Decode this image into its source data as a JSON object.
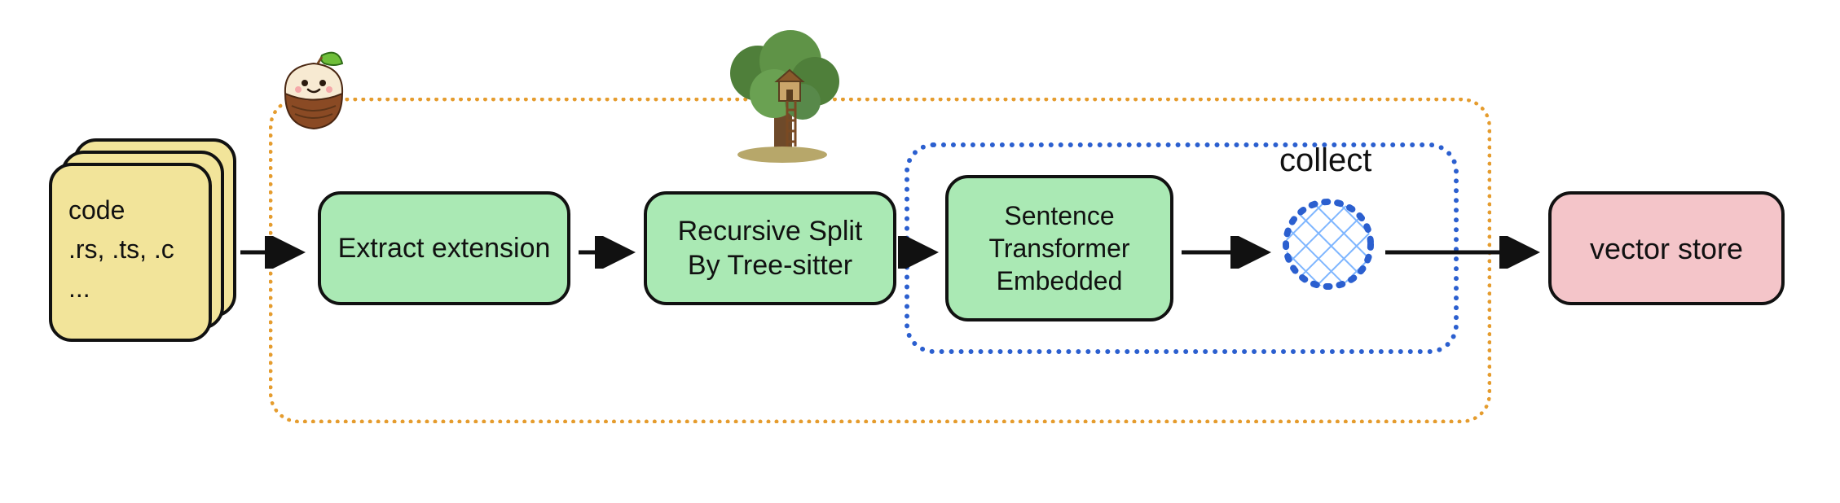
{
  "diagram": {
    "input": {
      "line1": "code",
      "line2": ".rs, .ts, .c",
      "line3": "..."
    },
    "steps": {
      "extract": "Extract extension",
      "split": "Recursive Split\nBy Tree-sitter",
      "embed": "Sentence\nTransformer\nEmbedded",
      "collect_label": "collect"
    },
    "output": "vector store"
  },
  "colors": {
    "input_bg": "#f2e49a",
    "step_bg": "#aae9b4",
    "output_bg": "#f4c5c9",
    "outer_dotted": "#e59c2e",
    "inner_dotted": "#2b5fcf",
    "hatch": "#7fb6ff",
    "stroke": "#111111"
  }
}
